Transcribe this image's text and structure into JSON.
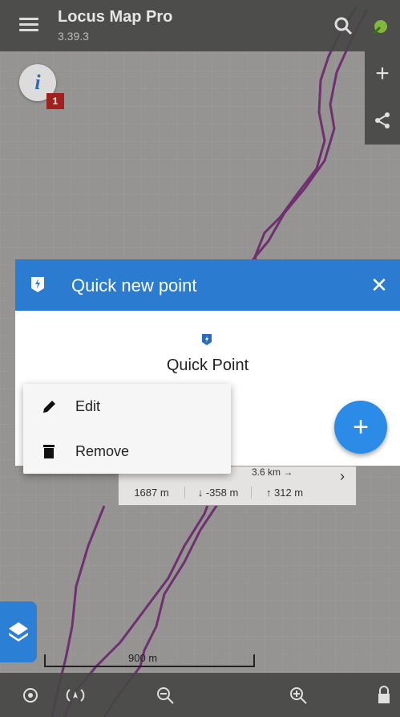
{
  "header": {
    "app_title": "Locus Map Pro",
    "version": "3.39.3"
  },
  "info_badge": "1",
  "dialog": {
    "title": "Quick new point",
    "close_glyph": "✕",
    "point_name": "Quick Point",
    "fab_glyph": "+"
  },
  "track_info": {
    "distance": "3.6 km →",
    "stats": [
      "1687 m",
      "↓ -358 m",
      "↑ 312 m"
    ],
    "arrow_glyph": "›"
  },
  "context_menu": {
    "items": [
      {
        "label": "Edit",
        "icon": "pencil-icon"
      },
      {
        "label": "Remove",
        "icon": "trash-icon"
      }
    ]
  },
  "scale": {
    "label": "900 m"
  },
  "colors": {
    "accent": "#2b7bd1",
    "track": "#8a2a8a",
    "fab": "#2b8be6"
  },
  "right_toolbar": {
    "plus_glyph": "+"
  }
}
